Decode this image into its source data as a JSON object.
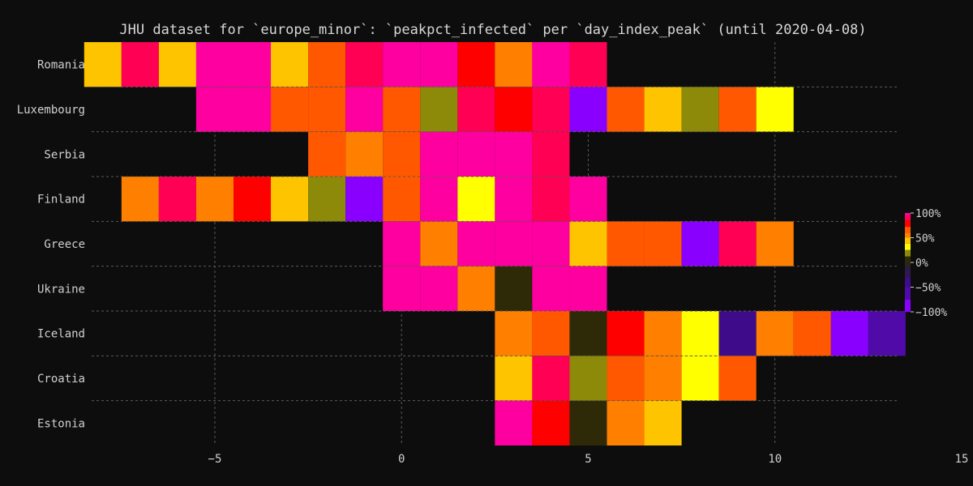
{
  "chart_data": {
    "type": "heatmap",
    "title": "JHU dataset for `europe_minor`: `peakpct_infected` per `day_index_peak` (until 2020-04-08)",
    "xlabel": "",
    "ylabel": "",
    "x_ticks": [
      -5,
      0,
      5,
      10,
      15
    ],
    "xlim": [
      -8.3,
      15
    ],
    "grid": true,
    "countries": [
      "Romania",
      "Luxembourg",
      "Serbia",
      "Finland",
      "Greece",
      "Ukraine",
      "Iceland",
      "Croatia",
      "Estonia"
    ],
    "rows": [
      {
        "name": "Romania",
        "start": -8,
        "values": [
          72,
          92,
          72,
          100,
          100,
          72,
          55,
          92,
          100,
          100,
          85,
          60,
          100,
          92
        ]
      },
      {
        "name": "Luxembourg",
        "start": -5,
        "values": [
          100,
          100,
          55,
          55,
          100,
          55,
          20,
          92,
          85,
          92,
          -100,
          55,
          72,
          20,
          55,
          40
        ]
      },
      {
        "name": "Serbia",
        "start": -2,
        "values": [
          55,
          60,
          55,
          100,
          100,
          100,
          92
        ]
      },
      {
        "name": "Finland",
        "start": -7,
        "values": [
          60,
          92,
          60,
          85,
          72,
          20,
          -100,
          55,
          100,
          40,
          100,
          92,
          100
        ]
      },
      {
        "name": "Greece",
        "start": 0,
        "values": [
          100,
          60,
          100,
          100,
          100,
          72,
          55,
          55,
          -100,
          92,
          60
        ]
      },
      {
        "name": "Ukraine",
        "start": 0,
        "values": [
          100,
          100,
          60,
          5,
          100,
          100
        ]
      },
      {
        "name": "Iceland",
        "start": 3,
        "values": [
          60,
          55,
          5,
          85,
          60,
          40,
          -55,
          60,
          55,
          -100,
          -75
        ]
      },
      {
        "name": "Croatia",
        "start": 3,
        "values": [
          72,
          92,
          20,
          55,
          60,
          40,
          55
        ]
      },
      {
        "name": "Estonia",
        "start": 3,
        "values": [
          100,
          85,
          5,
          60,
          72
        ]
      }
    ],
    "colorbar": {
      "min": -100,
      "max": 100,
      "ticks": [
        {
          "value": 100,
          "label": "100%"
        },
        {
          "value": 50,
          "label": "50%"
        },
        {
          "value": 0,
          "label": "0%"
        },
        {
          "value": -50,
          "label": "−50%"
        },
        {
          "value": -100,
          "label": "−100%"
        }
      ]
    },
    "colors": {
      "background": "#0d0d0d",
      "grid": "#5a5a5a",
      "text": "#d0d0d0"
    }
  }
}
